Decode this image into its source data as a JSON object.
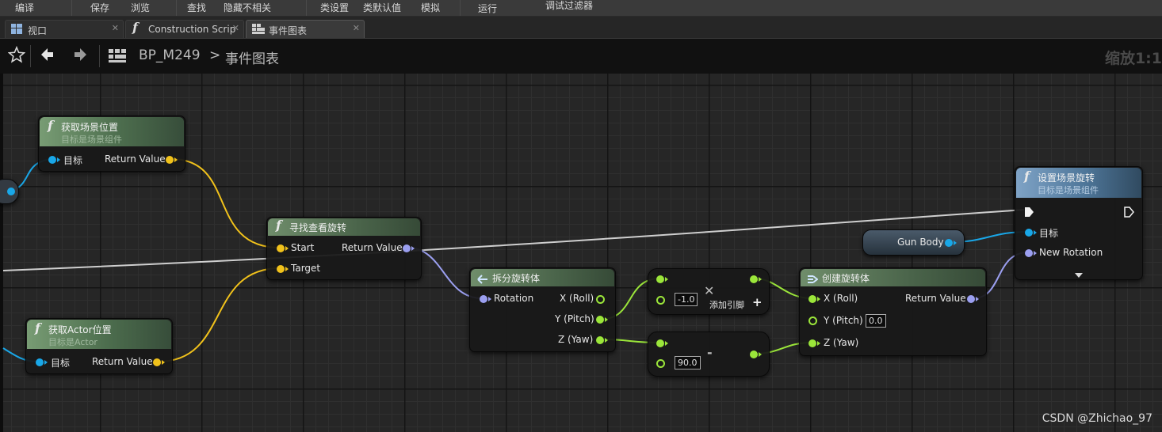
{
  "toolbar": {
    "items": [
      "编译",
      "保存",
      "浏览",
      "查找",
      "隐藏不相关",
      "类设置",
      "类默认值",
      "模拟",
      "运行",
      "调试过滤器"
    ]
  },
  "tabs": [
    {
      "label": "视口",
      "icon": "viewport-icon"
    },
    {
      "label": "Construction Scrip",
      "icon": "function-icon"
    },
    {
      "label": "事件图表",
      "icon": "event-graph-icon",
      "active": true
    }
  ],
  "breadcrumb": {
    "blueprint": "BP_M249",
    "separator": ">",
    "graph": "事件图表",
    "zoom": "缩放1:1"
  },
  "nodes": {
    "get_location": {
      "title": "获取场景位置",
      "subtitle": "目标是场景组件",
      "pin_target": "目标",
      "pin_return": "Return Value"
    },
    "get_actor_location": {
      "title": "获取Actor位置",
      "subtitle": "目标是Actor",
      "pin_target": "目标",
      "pin_return": "Return Value"
    },
    "find_look_at": {
      "title": "寻找查看旋转",
      "pin_start": "Start",
      "pin_target": "Target",
      "pin_return": "Return Value"
    },
    "break_rotator": {
      "title": "拆分旋转体",
      "pin_rotation": "Rotation",
      "pin_x": "X (Roll)",
      "pin_y": "Y (Pitch)",
      "pin_z": "Z (Yaw)"
    },
    "multiply": {
      "value": "-1.0",
      "add_pin": "添加引脚",
      "symbol": "✕"
    },
    "subtract": {
      "value": "90.0",
      "symbol": "-"
    },
    "make_rotator": {
      "title": "创建旋转体",
      "pin_x": "X (Roll)",
      "pin_y": "Y (Pitch)",
      "pin_y_value": "0.0",
      "pin_z": "Z (Yaw)",
      "pin_return": "Return Value"
    },
    "gun_body": {
      "label": "Gun Body"
    },
    "set_rotation": {
      "title": "设置场景旋转",
      "subtitle": "目标是场景组件",
      "pin_target": "目标",
      "pin_rotation": "New Rotation"
    }
  },
  "colors": {
    "vector_pin": "#f1c21b",
    "object_pin": "#19a7e8",
    "rotator_pin": "#9b9ff0",
    "float_pin": "#9be63a",
    "exec_wire": "#cfcfcf"
  },
  "watermark": "CSDN @Zhichao_97"
}
